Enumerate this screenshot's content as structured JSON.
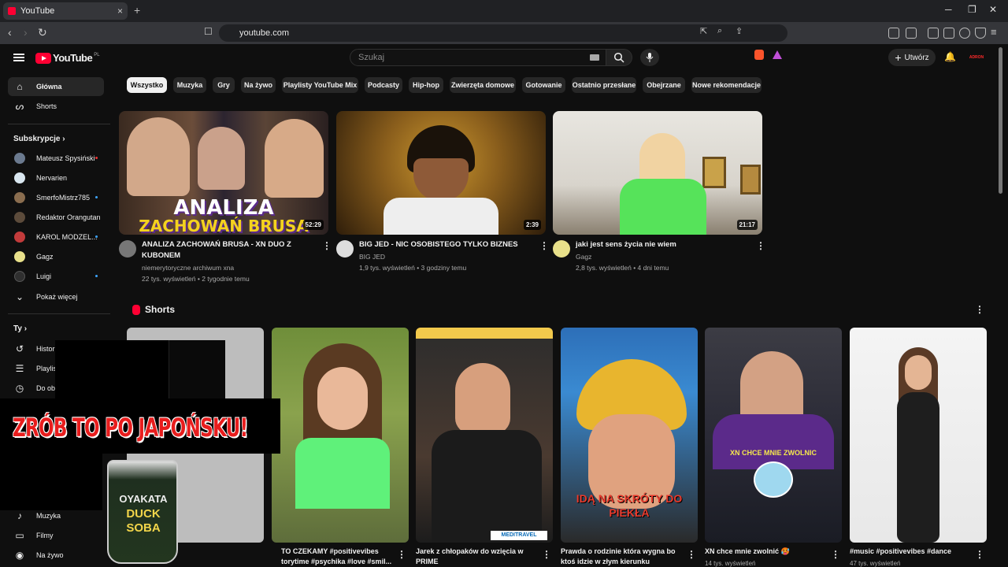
{
  "browser": {
    "tab_title": "YouTube",
    "tab_close": "×",
    "new_tab": "+",
    "url": "youtube.com",
    "win_min": "─",
    "win_max": "❐",
    "win_close": "✕"
  },
  "header": {
    "logo_text": "YouTube",
    "logo_country": "PL",
    "search_placeholder": "Szukaj",
    "create_label": "Utwórz",
    "account_badge": "ADRON"
  },
  "sidebar": {
    "main": [
      {
        "label": "Główna",
        "icon": "home-icon"
      },
      {
        "label": "Shorts",
        "icon": "shorts-icon"
      }
    ],
    "subscriptions_title": "Subskrypcje",
    "subscriptions": [
      {
        "label": "Mateusz Spysiński",
        "color": "#6b7a8f"
      },
      {
        "label": "Nervarien",
        "color": "#d9e6ef"
      },
      {
        "label": "SmerfoMistrz785",
        "color": "#8a6d4f"
      },
      {
        "label": "Redaktor Orangutan",
        "color": "#5c4b3b"
      },
      {
        "label": "KAROL MODZEL...",
        "color": "#c23b3b"
      },
      {
        "label": "Gagz",
        "color": "#e8e08a"
      },
      {
        "label": "Luigi",
        "color": "#2f2f2f"
      }
    ],
    "show_more": "Pokaż więcej",
    "you_title": "Ty",
    "you_items": [
      {
        "label": "Historia",
        "icon": "history-icon"
      },
      {
        "label": "Playlisty",
        "icon": "playlist-icon"
      },
      {
        "label": "Do obejrzenia",
        "icon": "watch-later-icon"
      }
    ],
    "explore_items": [
      {
        "label": "Muzyka",
        "icon": "music-icon"
      },
      {
        "label": "Filmy",
        "icon": "movies-icon"
      },
      {
        "label": "Na żywo",
        "icon": "live-icon"
      }
    ]
  },
  "chips": [
    "Wszystko",
    "Muzyka",
    "Gry",
    "Na żywo",
    "Playlisty YouTube Mix",
    "Podcasty",
    "Hip-hop",
    "Zwierzęta domowe",
    "Gotowanie",
    "Ostatnio przesłane",
    "Obejrzane",
    "Nowe rekomendacje"
  ],
  "videos": [
    {
      "title": "ANALIZA ZACHOWAŃ BRUSA - XN DUO Z KUBONEM",
      "channel": "niemerytoryczne archiwum xna",
      "stats": "22 tys. wyświetleń • 2 tygodnie temu",
      "duration": "52:29",
      "thumb_text1": "ANALIZA",
      "thumb_text2": "ZACHOWAŃ BRUSA"
    },
    {
      "title": "BIG JED - NIC OSOBISTEGO TYLKO BIZNES",
      "channel": "BIG JED",
      "stats": "1,9 tys. wyświetleń • 3 godziny temu",
      "duration": "2:39"
    },
    {
      "title": "jaki jest sens życia nie wiem",
      "channel": "Gagz",
      "stats": "2,8 tys. wyświetleń • 4 dni temu",
      "duration": "21:17"
    }
  ],
  "shorts": {
    "title": "Shorts",
    "items": [
      {
        "title": "TO CZEKAMY #positivevibes",
        "line2": "torytime #psychika #love #smil...",
        "meta": ""
      },
      {
        "title": "Jarek z chłopaków do wzięcia w",
        "line2": "PRIME",
        "meta": "",
        "overlay": "MEDITRAVEL"
      },
      {
        "title": "Prawda o rodzinie która wygna bo",
        "line2": "ktoś idzie w złym kierunku",
        "meta": "",
        "overlay": "IDĄ NA SKRÓTY DO PIEKŁA"
      },
      {
        "title": "XN chce mnie zwolnić 🥵",
        "line2": "",
        "meta": "14 tys. wyświetleń",
        "overlay": "XN CHCE MNIE ZWOLNIC"
      },
      {
        "title": "#music #positivevibes #dance",
        "line2": "",
        "meta": "47 tys. wyświetleń"
      }
    ]
  },
  "ad": {
    "headline": "ZRÓB TO PO JAPOŃSKU!",
    "product_line1": "OYAKATA",
    "product_line2": "DUCK",
    "product_line3": "SOBA"
  },
  "colors": {
    "brand": "#ff0033",
    "bg": "#0f0f0f",
    "chip": "#272727",
    "ad_red": "#e81d1d"
  }
}
